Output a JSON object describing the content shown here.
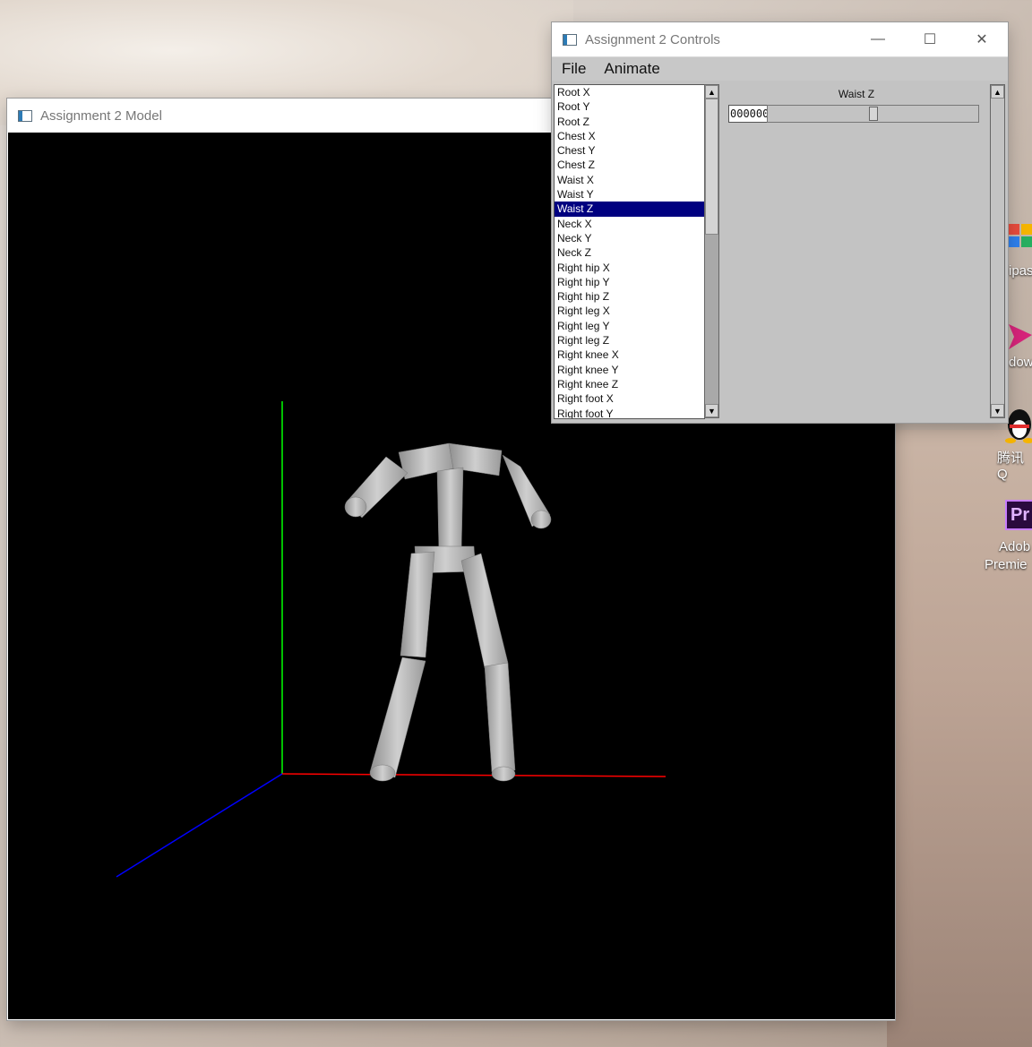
{
  "model_window": {
    "title": "Assignment 2 Model",
    "viewport": {
      "axis_colors": {
        "x": "#ff0000",
        "y": "#00ff00",
        "z": "#0000ff"
      },
      "figure_color": "#bdbdbd"
    }
  },
  "controls_window": {
    "title": "Assignment 2 Controls",
    "buttons": {
      "minimize_icon": "minimize-icon",
      "maximize_icon": "maximize-icon",
      "close_icon": "close-icon"
    },
    "menu": [
      "File",
      "Animate"
    ],
    "joints": [
      "Root X",
      "Root Y",
      "Root Z",
      "Chest X",
      "Chest Y",
      "Chest Z",
      "Waist X",
      "Waist Y",
      "Waist Z",
      "Neck X",
      "Neck Y",
      "Neck Z",
      "Right hip X",
      "Right hip Y",
      "Right hip Z",
      "Right leg X",
      "Right leg Y",
      "Right leg Z",
      "Right knee X",
      "Right knee Y",
      "Right knee Z",
      "Right foot X",
      "Right foot Y"
    ],
    "selected_joint": "Waist Z",
    "slider": {
      "label": "Waist Z",
      "value_text": "000000",
      "position": 0.5
    },
    "selection_color": "#000080"
  },
  "desktop": {
    "icons": [
      {
        "icon": "app-icon",
        "label": "ipas"
      },
      {
        "icon": "paper-plane-icon",
        "label": "dow"
      },
      {
        "icon": "qq-penguin-icon",
        "label": "腾讯Q"
      },
      {
        "icon": "premiere-icon",
        "badge": "Pr",
        "label": "Adob",
        "label2": "Premie"
      }
    ]
  }
}
